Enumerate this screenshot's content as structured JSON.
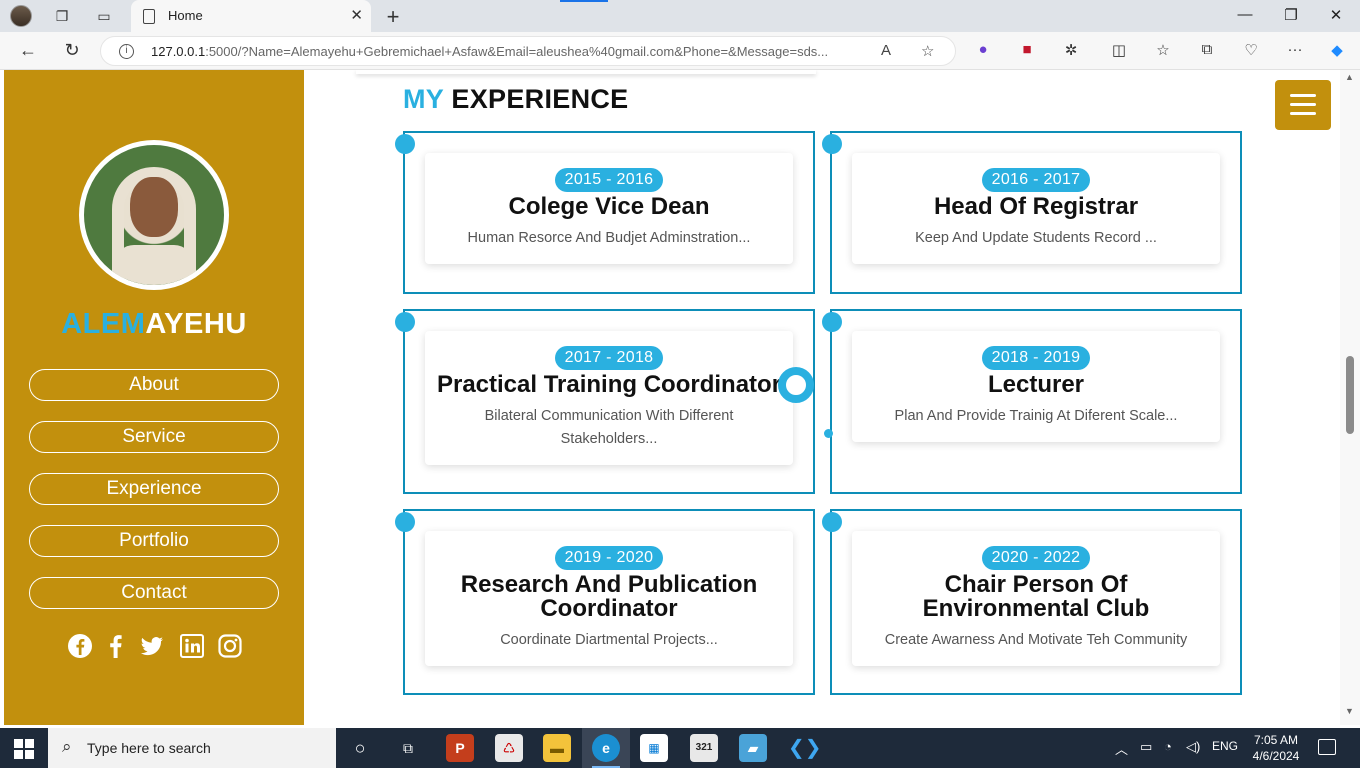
{
  "browser": {
    "tab_title": "Home",
    "url_host": "127.0.0.1",
    "url_rest": ":5000/?Name=Alemayehu+Gebremichael+Asfaw&Email=aleushea%40gmail.com&Phone=&Message=sds..."
  },
  "sidebar": {
    "brand_highlight": "ALEM",
    "brand_rest": "AYEHU",
    "nav": [
      {
        "label": "About"
      },
      {
        "label": "Service"
      },
      {
        "label": "Experience"
      },
      {
        "label": "Portfolio"
      },
      {
        "label": "Contact"
      }
    ],
    "social_icons": [
      "facebook-circle-icon",
      "facebook-icon",
      "twitter-icon",
      "linkedin-icon",
      "instagram-icon"
    ]
  },
  "section": {
    "title_highlight": "MY",
    "title_rest": " EXPERIENCE"
  },
  "experience": [
    {
      "years": "2015 - 2016",
      "role": "Colege Vice Dean",
      "desc": "Human Resorce And Budjet Adminstration..."
    },
    {
      "years": "2016 - 2017",
      "role": "Head Of Registrar",
      "desc": "Keep And Update Students Record ..."
    },
    {
      "years": "2017 - 2018",
      "role": "Practical Training Coordinator",
      "desc": "Bilateral Communication With Different Stakeholders..."
    },
    {
      "years": "2018 - 2019",
      "role": "Lecturer",
      "desc": "Plan And Provide Trainig At Diferent Scale..."
    },
    {
      "years": "2019 - 2020",
      "role": "Research And Publication Coordinator",
      "desc": "Coordinate Diartmental Projects..."
    },
    {
      "years": "2020 - 2022",
      "role": "Chair Person Of Environmental Club",
      "desc": "Create Awarness And Motivate Teh Community"
    }
  ],
  "taskbar": {
    "search_placeholder": "Type here to search",
    "language": "ENG",
    "time": "7:05 AM",
    "date": "4/6/2024"
  },
  "colors": {
    "accent": "#2ab0e0",
    "sidebar": "#c2900d",
    "card_border": "#0d8eb8"
  }
}
